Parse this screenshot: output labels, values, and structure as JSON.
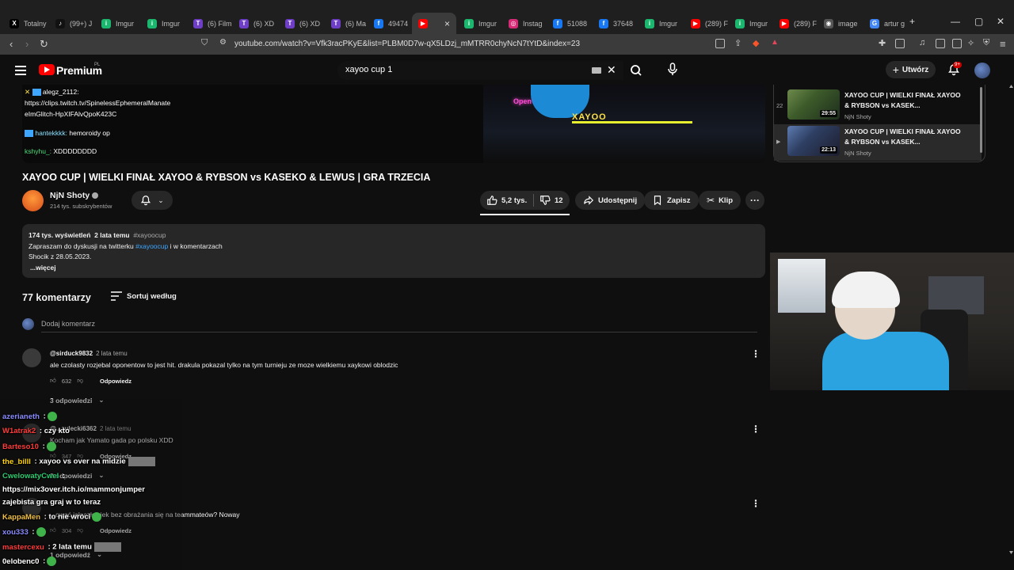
{
  "browser": {
    "tabs": [
      {
        "label": "Totalny",
        "color": "#000000",
        "glyph": "X"
      },
      {
        "label": "(99+) J",
        "color": "#111111",
        "glyph": "♪"
      },
      {
        "label": "Imgur",
        "color": "#1bb76e",
        "glyph": "i"
      },
      {
        "label": "Imgur",
        "color": "#1bb76e",
        "glyph": "i"
      },
      {
        "label": "(6) Film",
        "color": "#6f3ec6",
        "glyph": "T"
      },
      {
        "label": "(6) XD",
        "color": "#6f3ec6",
        "glyph": "T"
      },
      {
        "label": "(6) XD",
        "color": "#6f3ec6",
        "glyph": "T"
      },
      {
        "label": "(6) Ma",
        "color": "#6f3ec6",
        "glyph": "T"
      },
      {
        "label": "49474",
        "color": "#1877f2",
        "glyph": "f"
      },
      {
        "label": "",
        "color": "#ff0000",
        "glyph": "▶",
        "active": true
      },
      {
        "label": "Imgur",
        "color": "#1bb76e",
        "glyph": "i"
      },
      {
        "label": "Instag",
        "color": "#d62976",
        "glyph": "◎"
      },
      {
        "label": "51088",
        "color": "#1877f2",
        "glyph": "f"
      },
      {
        "label": "37648",
        "color": "#1877f2",
        "glyph": "f"
      },
      {
        "label": "Imgur",
        "color": "#1bb76e",
        "glyph": "i"
      },
      {
        "label": "(289) F",
        "color": "#ff0000",
        "glyph": "▶"
      },
      {
        "label": "Imgur",
        "color": "#1bb76e",
        "glyph": "i"
      },
      {
        "label": "(289) F",
        "color": "#ff0000",
        "glyph": "▶"
      },
      {
        "label": "image",
        "color": "#555555",
        "glyph": "◉"
      },
      {
        "label": "artur g",
        "color": "#4285f4",
        "glyph": "G"
      }
    ],
    "url": "youtube.com/watch?v=Vfk3racPKyE&list=PLBM0D7w-qX5LDzj_mMTRR0chyNcN7tYtD&index=23"
  },
  "header": {
    "premium_label": "Premium",
    "region": "PL",
    "search_value": "xayoo cup 1",
    "create_label": "Utwórz",
    "notif_count": "9+"
  },
  "video": {
    "chat_lines": [
      {
        "user": "alegz_2112:",
        "text": ""
      },
      {
        "user": "",
        "text": "https://clips.twitch.tv/SpinelessEphemeralManate"
      },
      {
        "user": "",
        "text": "eImGlitch-HpXIFAlvQpoK423C"
      },
      {
        "user": "hantekkkk:",
        "text": " hemoroidy op"
      },
      {
        "user": "kshyhu_:",
        "text": " XDDDDDDDD"
      }
    ],
    "neon_text": "Open",
    "logo_text": "XAYOO",
    "title": "XAYOO CUP | WIELKI FINAŁ XAYOO & RYBSON vs KASEKO & LEWUS | GRA TRZECIA"
  },
  "channel": {
    "name": "NjN Shoty",
    "subscribers": "214 tys. subskrybentów"
  },
  "actions": {
    "likes": "5,2 tys.",
    "dislikes": "12",
    "share": "Udostępnij",
    "save": "Zapisz",
    "clip": "Klip"
  },
  "description": {
    "views": "174 tys. wyświetleń",
    "age": "2 lata temu",
    "tag": "#xayoocup",
    "line1_pre": "Zapraszam do dyskusji na twitterku ",
    "line1_link": "#xayoocup",
    "line1_post": " i w komentarzach",
    "line2": "Shocik z 28.05.2023.",
    "more": "...więcej"
  },
  "comments": {
    "count_label": "77 komentarzy",
    "sort_label": "Sortuj według",
    "add_placeholder": "Dodaj komentarz",
    "items": [
      {
        "user": "@sirduck9832",
        "when": "2 lata temu",
        "text": "ale czolasty rozjebal oponentow to jest hit. drakula pokazal tylko na tym turnieju ze moze wielkiemu xaykowi oblodzic",
        "likes": "632",
        "reply": "Odpowiedz",
        "replies": "3 odpowiedzi"
      },
      {
        "user": "@...zulecki6362",
        "when": "2 lata temu",
        "text": "Kocham jak Yamato gada po polsku XDD",
        "likes": "347",
        "reply": "Odpowiedz",
        "replies": "2 odpowiedzi"
      },
      {
        "user": "",
        "when": "",
        "text": "...ować jak człowiek bez obrażania się na teammateów? Noway",
        "likes": "304",
        "reply": "Odpowiedz",
        "replies": "1 odpowiedź"
      }
    ]
  },
  "playlist": {
    "items": [
      {
        "index": "22",
        "title": "XAYOO CUP | WIELKI FINAŁ XAYOO & RYBSON vs KASEK...",
        "duration": "29:55",
        "channel": "NjN Shoty"
      },
      {
        "index": "▶",
        "title": "XAYOO CUP | WIELKI FINAŁ XAYOO & RYBSON vs KASEK...",
        "duration": "22:13",
        "channel": "NjN Shoty"
      }
    ]
  },
  "twitch_chat": [
    {
      "user": "azerianeth",
      "color": "#8a8cff",
      "text": " :",
      "emote": true
    },
    {
      "user": "W1atrak2",
      "color": "#ff3b3b",
      "text": " : czy kto",
      "emote": false
    },
    {
      "user": "Barteso10",
      "color": "#ff3b3b",
      "text": " :",
      "emote": true
    },
    {
      "user": "the_billl",
      "color": "#ffd400",
      "text": " : xayoo vs over na midzie",
      "emote": false,
      "rect": true
    },
    {
      "user": "CwelowatyCwel",
      "color": "#2ecc71",
      "text": " :",
      "emote": false
    },
    {
      "user": "",
      "color": "#ffffff",
      "text": "https://mix3over.itch.io/mammonjumper",
      "emote": false
    },
    {
      "user": "",
      "color": "#ffffff",
      "text": "zajebista gra graj w to teraz",
      "emote": false
    },
    {
      "user": "KappaMen",
      "color": "#f0c040",
      "text": " : to nie wróci",
      "emote": true
    },
    {
      "user": "xou333",
      "color": "#8a8cff",
      "text": " :",
      "emote": true
    },
    {
      "user": "mastercexu",
      "color": "#ff3b3b",
      "text": " : 2 lata temu",
      "emote": false,
      "rect": true
    },
    {
      "user": "0elobenc0",
      "color": "#ffffff",
      "text": " :",
      "emote": true
    }
  ]
}
